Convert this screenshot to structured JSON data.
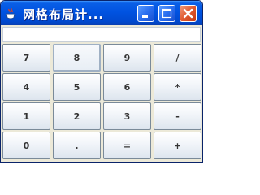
{
  "window": {
    "title": "网格布局计...",
    "icons": {
      "app": "java-cup-icon",
      "minimize": "minimize-icon",
      "maximize": "maximize-icon",
      "close": "close-icon"
    },
    "colors": {
      "titlebar": "#0053e1",
      "close_button": "#e05a30",
      "background": "#ece9d8"
    }
  },
  "display": {
    "value": ""
  },
  "keypad": {
    "rows": [
      [
        "7",
        "8",
        "9",
        "/"
      ],
      [
        "4",
        "5",
        "6",
        "*"
      ],
      [
        "1",
        "2",
        "3",
        "-"
      ],
      [
        "0",
        ".",
        "=",
        "+"
      ]
    ],
    "focused_key": "8"
  }
}
